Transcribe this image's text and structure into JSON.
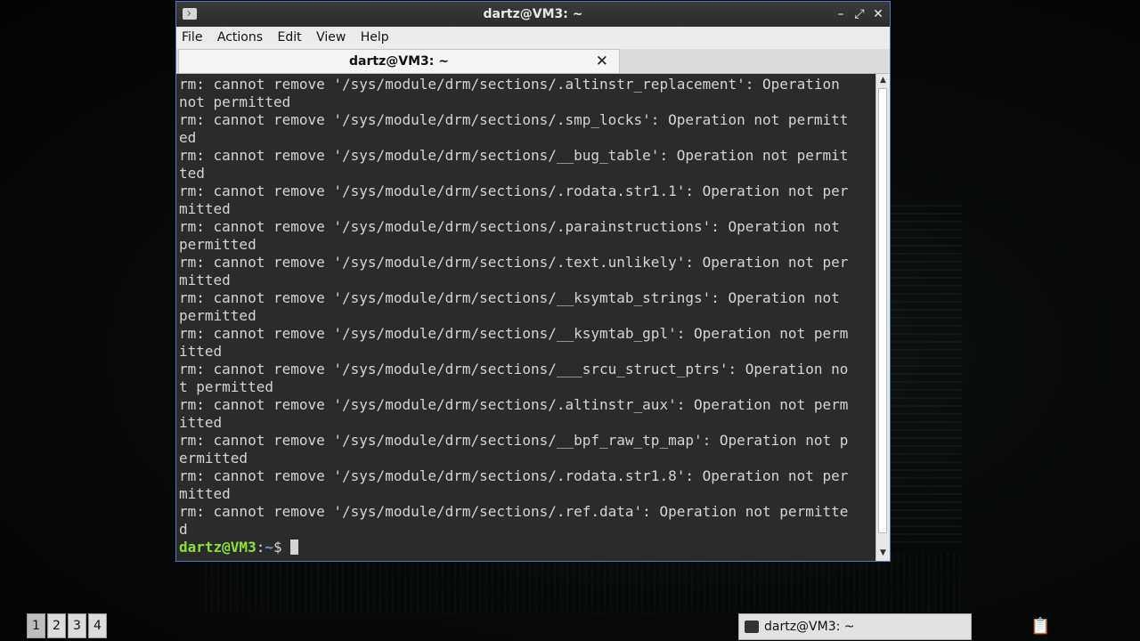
{
  "window": {
    "title": "dartz@VM3: ~",
    "buttons": {
      "minimize": "–",
      "maximize": "⤢",
      "close": "✕"
    }
  },
  "menubar": {
    "items": [
      "File",
      "Actions",
      "Edit",
      "View",
      "Help"
    ]
  },
  "tab": {
    "label": "dartz@VM3: ~",
    "close": "✕"
  },
  "terminal": {
    "lines": [
      "rm: cannot remove '/sys/module/drm/sections/.altinstr_replacement': Operation",
      "not permitted",
      "rm: cannot remove '/sys/module/drm/sections/.smp_locks': Operation not permitt",
      "ed",
      "rm: cannot remove '/sys/module/drm/sections/__bug_table': Operation not permit",
      "ted",
      "rm: cannot remove '/sys/module/drm/sections/.rodata.str1.1': Operation not per",
      "mitted",
      "rm: cannot remove '/sys/module/drm/sections/.parainstructions': Operation not",
      "permitted",
      "rm: cannot remove '/sys/module/drm/sections/.text.unlikely': Operation not per",
      "mitted",
      "rm: cannot remove '/sys/module/drm/sections/__ksymtab_strings': Operation not",
      "permitted",
      "rm: cannot remove '/sys/module/drm/sections/__ksymtab_gpl': Operation not perm",
      "itted",
      "rm: cannot remove '/sys/module/drm/sections/___srcu_struct_ptrs': Operation no",
      "t permitted",
      "rm: cannot remove '/sys/module/drm/sections/.altinstr_aux': Operation not perm",
      "itted",
      "rm: cannot remove '/sys/module/drm/sections/__bpf_raw_tp_map': Operation not p",
      "ermitted",
      "rm: cannot remove '/sys/module/drm/sections/.rodata.str1.8': Operation not per",
      "mitted",
      "rm: cannot remove '/sys/module/drm/sections/.ref.data': Operation not permitte",
      "d"
    ],
    "prompt": {
      "user_host": "dartz@VM3",
      "separator": ":",
      "path": "~",
      "symbol": "$ "
    }
  },
  "taskbar": {
    "workspaces": [
      "1",
      "2",
      "3",
      "4"
    ],
    "task_label": "dartz@VM3: ~",
    "tray_icon": "clipboard-icon"
  }
}
